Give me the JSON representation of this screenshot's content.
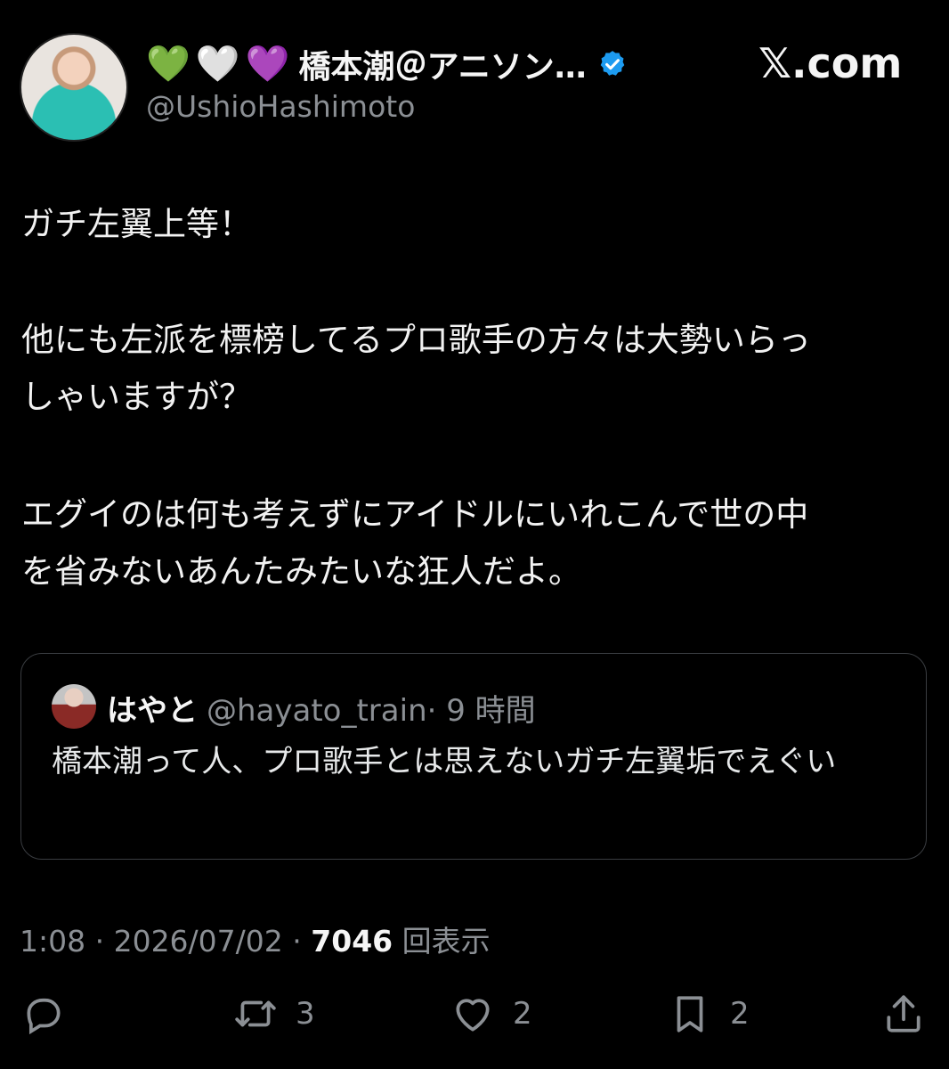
{
  "author": {
    "hearts": [
      "💚",
      "🤍",
      "💜"
    ],
    "display_name": "橋本潮＠アニソン…",
    "handle": "@UshioHashimoto",
    "verified_color": "#1d9bf0"
  },
  "brand": "𝕏.com",
  "post": {
    "lines": [
      "ガチ左翼上等！",
      "他にも左派を標榜してるプロ歌手の方々は大勢いらっ",
      "しゃいますが？",
      "エグイのは何も考えずにアイドルにいれこんで世の中",
      "を省みないあんたみたいな狂人だよ。"
    ]
  },
  "quote": {
    "name": "はやと",
    "handle": "@hayato_train",
    "time": "· 9 時間",
    "text": "橋本潮って人、プロ歌手とは思えないガチ左翼垢でえぐい"
  },
  "meta": {
    "time": "1:08 · 2026/07/02 ·",
    "views": "7046",
    "views_label": "回表示"
  },
  "actions": {
    "reply_icon": "reply-icon",
    "retweet_count": "3",
    "like_count": "2",
    "bookmark_count": "2",
    "share_icon": "share-icon"
  }
}
